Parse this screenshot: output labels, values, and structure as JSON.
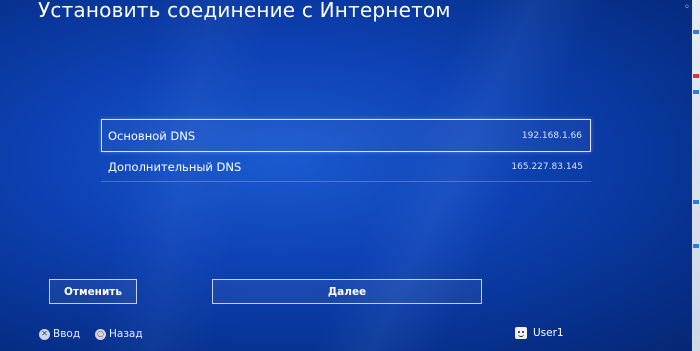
{
  "header": {
    "title": "Установить соединение с Интернетом",
    "corner_glyph": "◦"
  },
  "dns": {
    "items": [
      {
        "label": "Основной DNS",
        "value": "192.168.1.66",
        "selected": true
      },
      {
        "label": "Дополнительный DNS",
        "value": "165.227.83.145",
        "selected": false
      }
    ]
  },
  "buttons": {
    "cancel_label": "Отменить",
    "next_label": "Далее"
  },
  "footer": {
    "enter_icon": "cross-button-icon",
    "enter_label": "Ввод",
    "back_icon": "circle-button-icon",
    "back_label": "Назад",
    "user_icon": "user-avatar-icon",
    "user_name": "User1"
  },
  "colors": {
    "background": "#0d41b4",
    "text": "#ffffff"
  }
}
